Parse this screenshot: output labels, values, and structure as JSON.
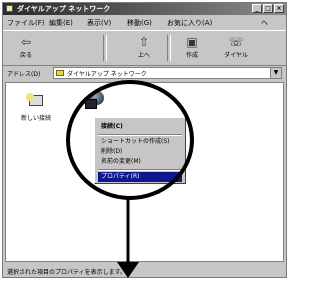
{
  "window": {
    "title": "ダイヤルアップ ネットワーク"
  },
  "menubar": {
    "items": [
      "ファイル(F)",
      "編集(E)",
      "表示(V)",
      "移動(G)",
      "お気に入り(A)",
      "ヘ"
    ]
  },
  "toolbar": {
    "buttons": [
      {
        "label": "戻る",
        "icon": "back-arrow-icon"
      },
      {
        "label": "上へ",
        "icon": "up-folder-icon"
      },
      {
        "label": "作成",
        "icon": "create-icon"
      },
      {
        "label": "ダイヤル",
        "icon": "dial-icon"
      }
    ]
  },
  "addressbar": {
    "label": "アドレス(D)",
    "value": "ダイヤルアップ ネットワーク"
  },
  "icons": {
    "new_connection": "新しい接続",
    "selected_connection": ""
  },
  "context_menu": {
    "items": [
      {
        "label": "接続(C)",
        "bold": true
      },
      {
        "label": "ショートカットの作成(S)"
      },
      {
        "label": "削除(D)"
      },
      {
        "label": "名前の変更(M)"
      },
      {
        "label": "プロパティ(R)",
        "highlighted": true
      }
    ]
  },
  "statusbar": {
    "text": "選択された項目のプロパティを表示します。"
  },
  "colors": {
    "menu_highlight": "#101890",
    "window_face": "#c6c6c6",
    "annotation": "#000000"
  }
}
